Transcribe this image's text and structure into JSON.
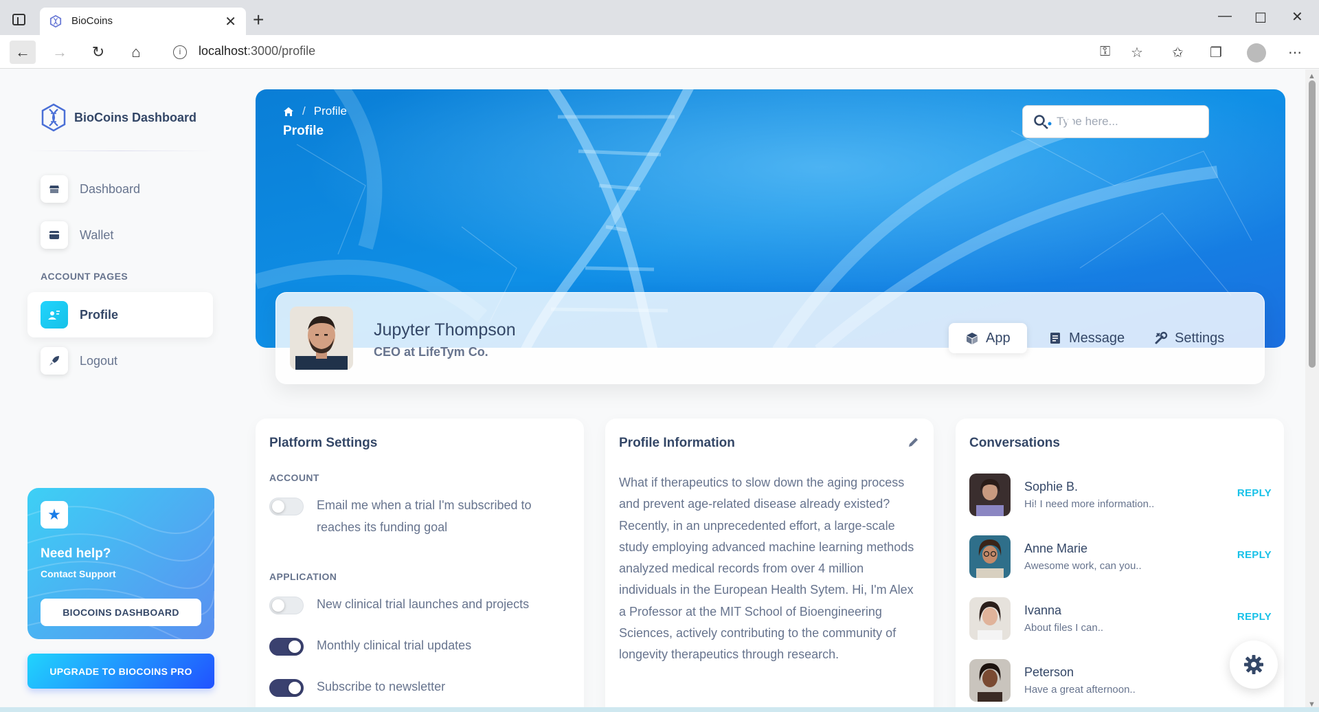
{
  "browser": {
    "tab_title": "BioCoins",
    "url_host": "localhost",
    "url_path": ":3000/profile"
  },
  "sidebar": {
    "brand": "BioCoins Dashboard",
    "items": [
      {
        "label": "Dashboard",
        "icon": "shop-icon"
      },
      {
        "label": "Wallet",
        "icon": "credit-card-icon"
      }
    ],
    "section": "ACCOUNT PAGES",
    "account_items": [
      {
        "label": "Profile",
        "icon": "person-icon",
        "active": true
      },
      {
        "label": "Logout",
        "icon": "rocket-icon"
      }
    ],
    "help": {
      "title": "Need help?",
      "subtitle": "Contact Support",
      "button": "BIOCOINS DASHBOARD"
    },
    "upgrade": "UPGRADE TO BIOCOINS PRO"
  },
  "header": {
    "breadcrumb": "Profile",
    "title": "Profile",
    "search_placeholder": "Type here..."
  },
  "profile": {
    "name": "Jupyter Thompson",
    "role": "CEO at LifeTym Co.",
    "tabs": [
      {
        "label": "App",
        "icon": "cube-icon",
        "active": true
      },
      {
        "label": "Message",
        "icon": "document-icon"
      },
      {
        "label": "Settings",
        "icon": "tools-icon"
      }
    ]
  },
  "platform_settings": {
    "title": "Platform Settings",
    "account_label": "ACCOUNT",
    "account_items": [
      {
        "label": "Email me when a trial I'm subscribed to reaches its funding goal",
        "on": false
      }
    ],
    "application_label": "APPLICATION",
    "application_items": [
      {
        "label": "New clinical trial launches and projects",
        "on": false
      },
      {
        "label": "Monthly clinical trial updates",
        "on": true
      },
      {
        "label": "Subscribe to newsletter",
        "on": true
      }
    ]
  },
  "profile_information": {
    "title": "Profile Information",
    "text": "What if therapeutics to slow down the aging process and prevent age-related disease already existed? Recently, in an unprecedented effort, a large-scale study employing advanced machine learning methods analyzed medical records from over 4 million individuals in the European Health Sytem. Hi, I'm Alex a Professor at the MIT School of Bioengineering Sciences, actively contributing to the community of longevity therapeutics through research."
  },
  "conversations": {
    "title": "Conversations",
    "reply_label": "REPLY",
    "items": [
      {
        "name": "Sophie B.",
        "message": "Hi! I need more information.."
      },
      {
        "name": "Anne Marie",
        "message": "Awesome work, can you.."
      },
      {
        "name": "Ivanna",
        "message": "About files I can.."
      },
      {
        "name": "Peterson",
        "message": "Have a great afternoon.."
      }
    ]
  },
  "colors": {
    "accent": "#17c1e8",
    "toggle_on": "#3a416f",
    "text": "#344767",
    "muted": "#67748e"
  }
}
